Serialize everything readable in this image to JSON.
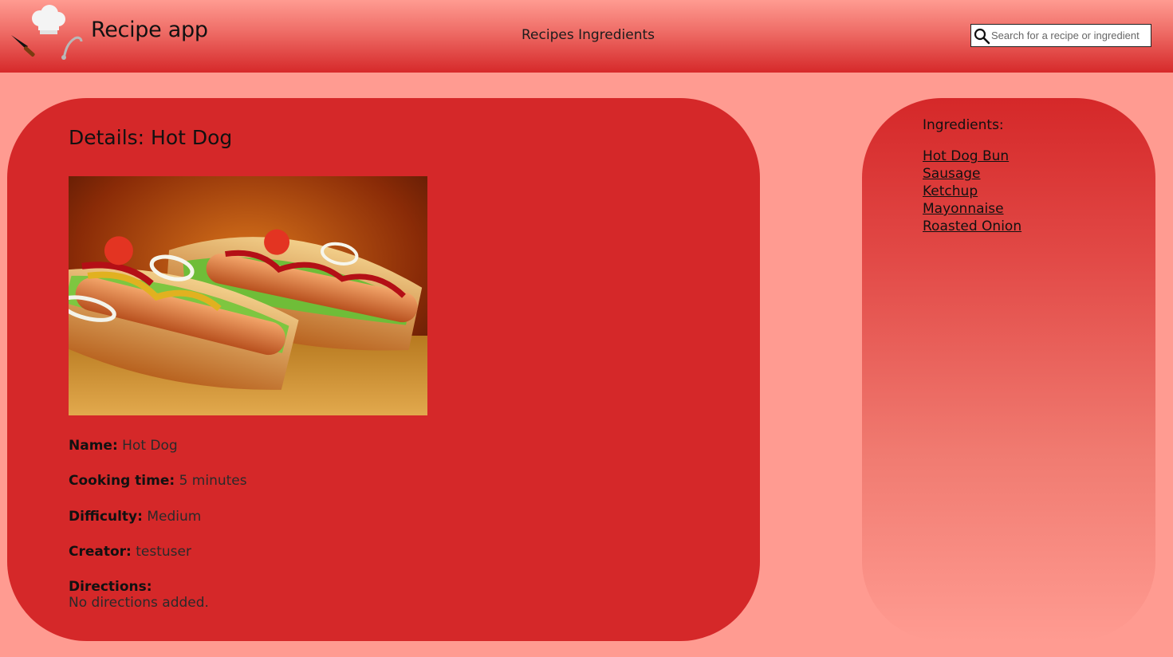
{
  "header": {
    "app_title": "Recipe app",
    "nav": {
      "recipes": "Recipes",
      "ingredients": "Ingredients"
    },
    "search": {
      "placeholder": "Search for a recipe or ingredient",
      "value": ""
    }
  },
  "details": {
    "title": "Details: Hot Dog",
    "image_alt": "Hot Dog",
    "fields": {
      "name_label": "Name:",
      "name_value": "Hot Dog",
      "cooking_time_label": "Cooking time:",
      "cooking_time_value": "5 minutes",
      "difficulty_label": "Difficulty:",
      "difficulty_value": "Medium",
      "creator_label": "Creator:",
      "creator_value": "testuser",
      "directions_label": "Directions:",
      "directions_value": "No directions added."
    }
  },
  "ingredients": {
    "title": "Ingredients:",
    "items": [
      "Hot Dog Bun",
      "Sausage",
      "Ketchup",
      "Mayonnaise",
      "Roasted Onion"
    ]
  },
  "colors": {
    "page_background": "#ff9b91",
    "panel_red": "#d52829",
    "header_dark": "#d6292a"
  },
  "icons": [
    "chef-hat-icon",
    "knife-icon",
    "ladle-icon",
    "search-icon"
  ]
}
